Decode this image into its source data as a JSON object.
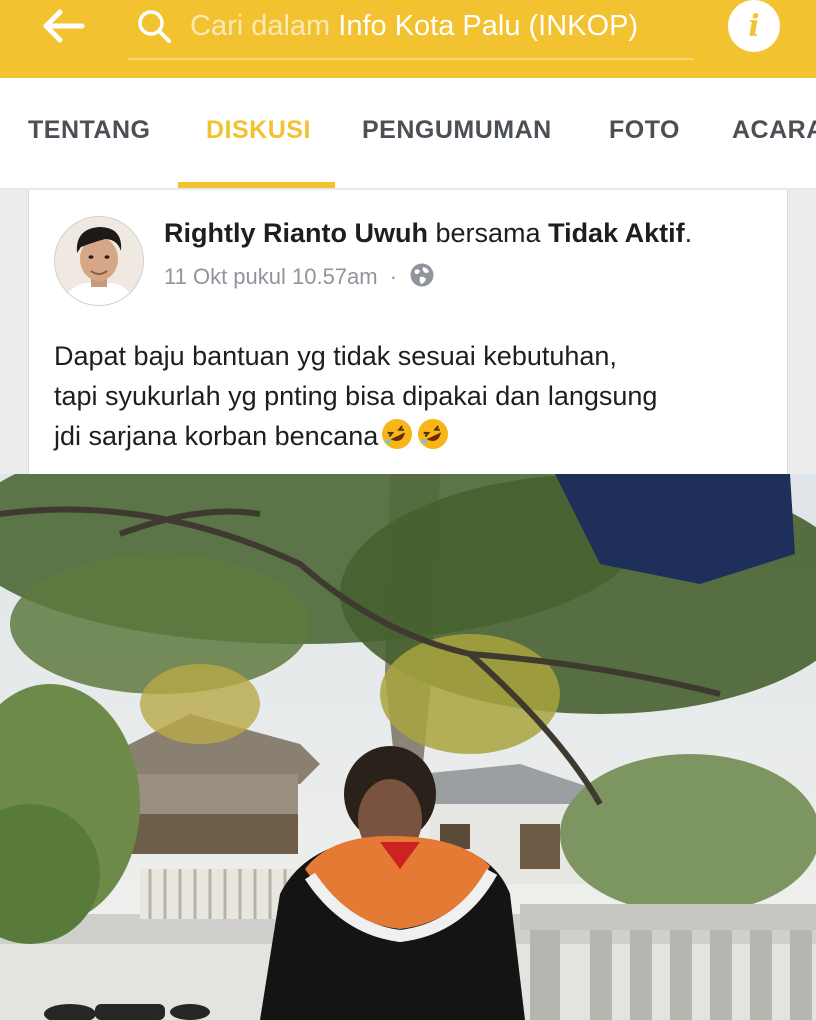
{
  "topbar": {
    "back_icon": "back-arrow-icon",
    "search_icon": "search-icon",
    "search_placeholder": "Cari dalam",
    "search_group": "Info Kota Palu (INKOP)",
    "info_icon": "info-icon",
    "info_glyph": "i",
    "accent": "#f2c230"
  },
  "tabs": [
    {
      "label": "TENTANG"
    },
    {
      "label": "DISKUSI",
      "active": true
    },
    {
      "label": "PENGUMUMAN"
    },
    {
      "label": "FOTO"
    },
    {
      "label": "ACARA"
    }
  ],
  "post": {
    "author": "Rightly Rianto Uwuh",
    "with_word": "bersama",
    "with_name": "Tidak Aktif",
    "period": ".",
    "timestamp": "11 Okt pukul 10.57am",
    "separator": "·",
    "privacy_icon": "globe-icon",
    "text_line1": "Dapat baju bantuan yg tidak sesuai kebutuhan,",
    "text_line2": "tapi syukurlah yg pnting bisa dipakai dan langsung",
    "text_line3": "jdi sarjana korban bencana",
    "emoji_icon": "rolling-laughing-emoji-icon"
  }
}
